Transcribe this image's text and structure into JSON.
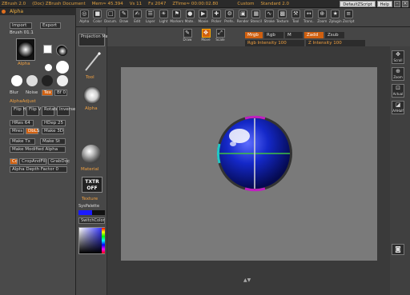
{
  "titlebar": {
    "app": "ZBrush 2.0",
    "doc": "(Doc) ZBrush Document",
    "mem": "Mem≈ 45.394",
    "vs": "Vs 11",
    "fx": "Fx 2047",
    "ztime": "ZTime≈ 00:00:02.80",
    "custom": "Custom",
    "standard": "Standard 2.0",
    "script_btn": "DefaultZScript",
    "help_btn": "Help"
  },
  "toolbar": {
    "items": [
      {
        "label": "Alpha",
        "icon": "◎"
      },
      {
        "label": "Color",
        "icon": "■"
      },
      {
        "label": "Docum.",
        "icon": "□"
      },
      {
        "label": "Draw",
        "icon": "✎"
      },
      {
        "label": "Edit",
        "icon": "✍"
      },
      {
        "label": "Layer",
        "icon": "☰"
      },
      {
        "label": "Light",
        "icon": "☀"
      },
      {
        "label": "Markers",
        "icon": "⚑"
      },
      {
        "label": "Mate..",
        "icon": "●"
      },
      {
        "label": "Movie",
        "icon": "▶"
      },
      {
        "label": "Picker",
        "icon": "✚"
      },
      {
        "label": "Prefe..",
        "icon": "⚙"
      },
      {
        "label": "Render",
        "icon": "▣"
      },
      {
        "label": "Stencil",
        "icon": "▦"
      },
      {
        "label": "Stroke",
        "icon": "∿"
      },
      {
        "label": "Texture",
        "icon": "▩"
      },
      {
        "label": "Tool",
        "icon": "⚒"
      },
      {
        "label": "Trans..",
        "icon": "↔"
      },
      {
        "label": "Zoom",
        "icon": "⊕"
      },
      {
        "label": "Zplugin",
        "icon": "★"
      },
      {
        "label": "Zscript",
        "icon": "≡"
      }
    ]
  },
  "leftpanel": {
    "header": "Alpha",
    "import": "Import",
    "export": "Export",
    "brush": "Brush 01.1",
    "alpha_label": "Alpha",
    "blur": "Blur",
    "noise": "Noise",
    "tex": "Tex",
    "bf": "Bf 0",
    "alphaadjust": "AlphaAdjust",
    "flip_h": "Flip H",
    "flip_v": "Flip V",
    "rotate": "Rotate",
    "invert": "Inverse",
    "hres": "HRes 64",
    "hdep": "HDep 25",
    "mres": "Mres",
    "dbls": "DbLS",
    "make3d": "Make 3D",
    "make_tx": "Make Tx",
    "make_st": "Make St",
    "make_mod": "Make Modified Alpha",
    "cc": "Cc",
    "crop": "CropAndFill",
    "grabdoc": "GrabDoc",
    "depth": "Alpha Depth Factor 0"
  },
  "middlecol": {
    "projection": "Projection Master",
    "tool": "Tool",
    "alpha": "Alpha",
    "material": "Material",
    "txtr": "TXTR OFF",
    "texture": "Texture",
    "syspalette": "SysPalette",
    "switchcolor": "SwitchColor"
  },
  "subbar": {
    "draw": "Draw",
    "move": "Move",
    "scale": "Scale",
    "rgb_tab": "Mrgb",
    "rgb": "Rgb",
    "m": "M",
    "zadd": "Zadd",
    "zsub": "Zsub",
    "rgb_int_label": "Rgb Intensity",
    "rgb_int": "100",
    "z_int_label": "Z Intensity",
    "z_int": "100"
  },
  "rightshelf": {
    "scroll": "Scroll",
    "zoom": "Zoom",
    "actual": "Actual",
    "aahalf": "AAHalf"
  },
  "colors": {
    "accent": "#d06010",
    "sphere": "#1428c8",
    "canvas": "#7a7a7a"
  }
}
